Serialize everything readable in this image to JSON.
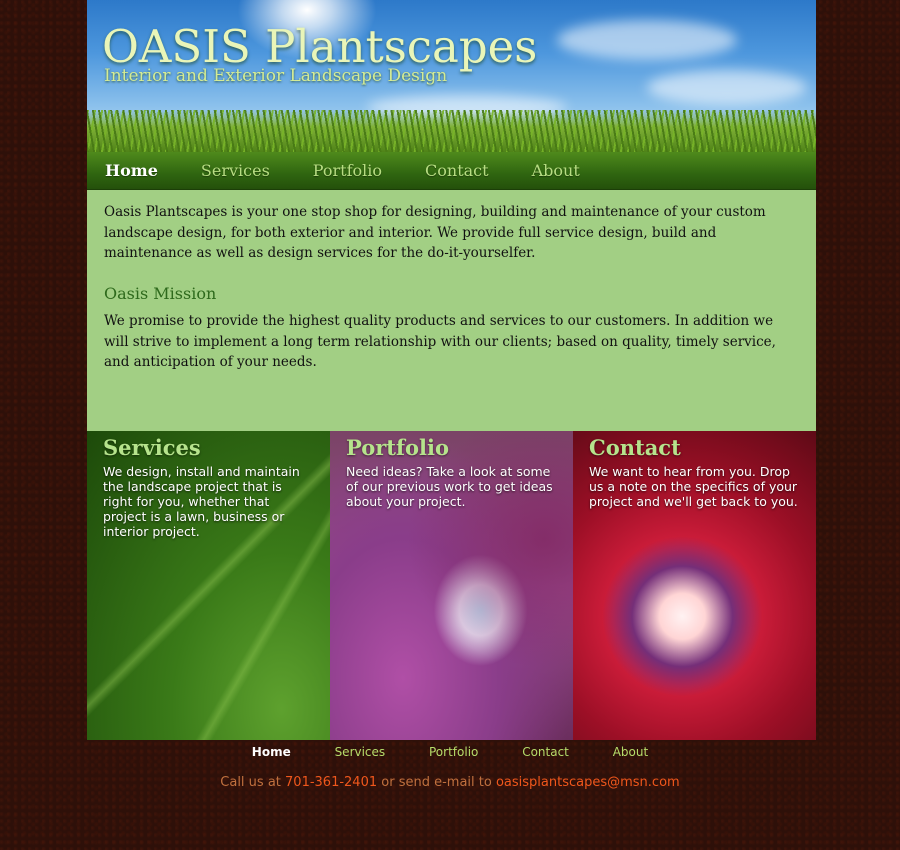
{
  "header": {
    "title": "OASIS Plantscapes",
    "subtitle": "Interior and Exterior Landscape Design"
  },
  "nav": {
    "items": [
      {
        "label": "Home",
        "active": true
      },
      {
        "label": "Services",
        "active": false
      },
      {
        "label": "Portfolio",
        "active": false
      },
      {
        "label": "Contact",
        "active": false
      },
      {
        "label": "About",
        "active": false
      }
    ]
  },
  "content": {
    "intro": "Oasis Plantscapes is your one stop shop for designing, building and maintenance of your custom landscape design, for both exterior and interior. We provide full service design, build and maintenance as well as design services for the do-it-yourselfer.",
    "mission_heading": "Oasis Mission",
    "mission_text": "We promise to provide the highest quality products and services to our customers. In addition we will strive to implement a long term relationship with our clients; based on quality, timely service, and anticipation of your needs."
  },
  "panels": [
    {
      "title": "Services",
      "text": "We design, install and maintain the landscape project that is right for you, whether that project is a lawn, business or interior project."
    },
    {
      "title": "Portfolio",
      "text": "Need ideas? Take a look at some of our previous work to get ideas about your project."
    },
    {
      "title": "Contact",
      "text": "We want to hear from you. Drop us a note on the specifics of your project and we'll get back to you."
    }
  ],
  "footer": {
    "nav": [
      {
        "label": "Home",
        "active": true
      },
      {
        "label": "Services",
        "active": false
      },
      {
        "label": "Portfolio",
        "active": false
      },
      {
        "label": "Contact",
        "active": false
      },
      {
        "label": "About",
        "active": false
      }
    ],
    "call_prefix": "Call us at",
    "phone": "701-361-2401",
    "mail_prefix": "or send e-mail to",
    "email": "oasisplantscapes@msn.com"
  },
  "colors": {
    "background": "#2e1009",
    "content_bg": "#a2cf84",
    "nav_green": "#2f6510",
    "accent_green": "#b6e38c",
    "footer_highlight": "#f0571c"
  }
}
